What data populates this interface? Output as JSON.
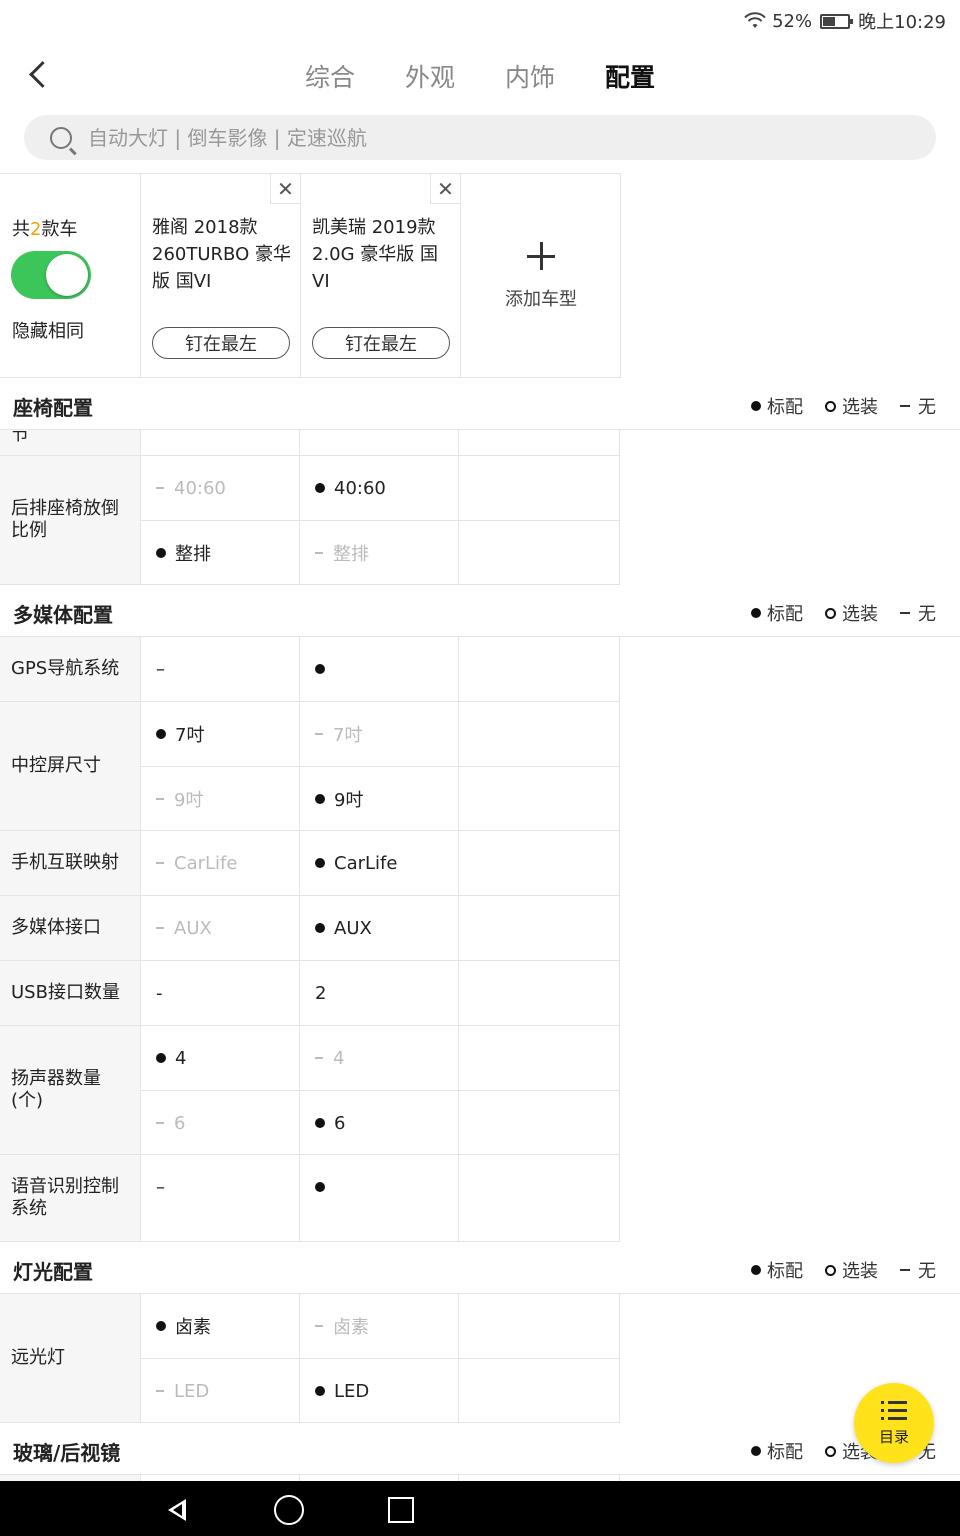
{
  "status_bar": {
    "wifi_icon": "wifi-icon",
    "battery_pct": "52%",
    "battery_level": 0.52,
    "time": "晚上10:29"
  },
  "header": {
    "tabs": [
      {
        "label": "综合",
        "active": false
      },
      {
        "label": "外观",
        "active": false
      },
      {
        "label": "内饰",
        "active": false
      },
      {
        "label": "配置",
        "active": true
      }
    ]
  },
  "search": {
    "placeholder": "自动大灯 | 倒车影像 | 定速巡航"
  },
  "compare": {
    "count_prefix": "共",
    "count_num": "2",
    "count_suffix": "款车",
    "hide_same_label": "隐藏相同",
    "hide_same_on": true,
    "cars": [
      {
        "name": "雅阁 2018款 260TURBO 豪华版 国VI",
        "pin_label": "钉在最左"
      },
      {
        "name": "凯美瑞 2019款 2.0G 豪华版 国VI",
        "pin_label": "钉在最左"
      }
    ],
    "add_label": "添加车型"
  },
  "legend": {
    "standard": "标配",
    "optional": "选装",
    "none": "无"
  },
  "sections": [
    {
      "title": "座椅配置"
    },
    {
      "title": "多媒体配置"
    },
    {
      "title": "灯光配置"
    },
    {
      "title": "玻璃/后视镜"
    }
  ],
  "rows": {
    "partial_label": "节",
    "rear_fold": {
      "label": "后排座椅放倒比例",
      "c1": [
        "40:60",
        "整排"
      ],
      "c2": [
        "40:60",
        "整排"
      ]
    },
    "gps": {
      "label": "GPS导航系统",
      "c1": "–",
      "c2": ""
    },
    "screen": {
      "label": "中控屏尺寸",
      "c1": [
        "7吋",
        "9吋"
      ],
      "c2": [
        "7吋",
        "9吋"
      ]
    },
    "phone": {
      "label": "手机互联映射",
      "c1": "CarLife",
      "c2": "CarLife"
    },
    "media": {
      "label": "多媒体接口",
      "c1": "AUX",
      "c2": "AUX"
    },
    "usb": {
      "label": "USB接口数量",
      "c1": "-",
      "c2": "2"
    },
    "speakers": {
      "label": "扬声器数量(个)",
      "c1": [
        "4",
        "6"
      ],
      "c2": [
        "4",
        "6"
      ]
    },
    "voice": {
      "label": "语音识别控制系统",
      "c1": "–",
      "c2": ""
    },
    "high_beam": {
      "label": "远光灯",
      "c1": [
        "卤素",
        "LED"
      ],
      "c2": [
        "卤素",
        "LED"
      ]
    }
  },
  "fab": {
    "label": "目录"
  }
}
